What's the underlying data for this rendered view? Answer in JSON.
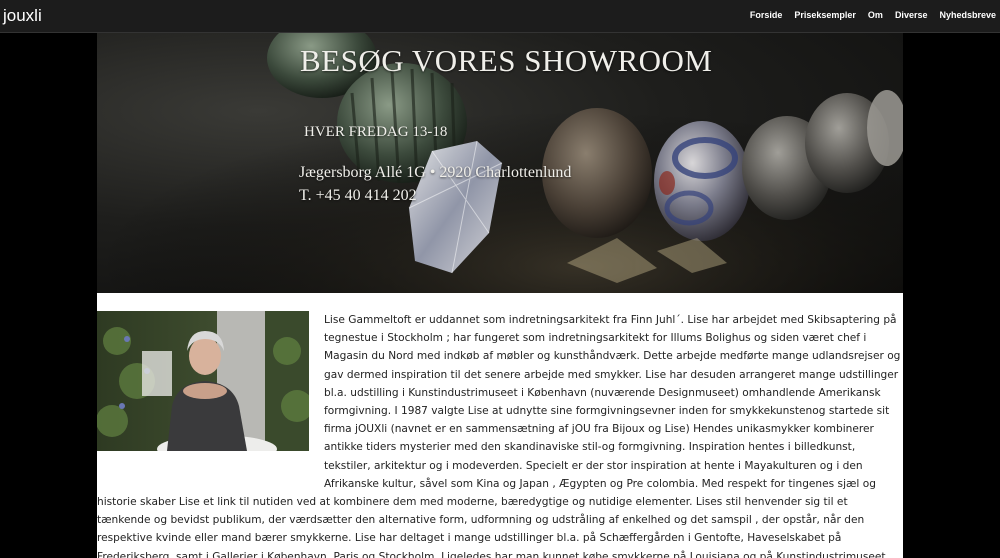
{
  "navbar": {
    "brand": "jouxli",
    "links": [
      "Forside",
      "Priseksempler",
      "Om",
      "Diverse",
      "Nyhedsbreve"
    ]
  },
  "hero": {
    "title": "BESØG VORES SHOWROOM",
    "days": "HVER FREDAG 13-18",
    "address": "Jægersborg Allé 1G • 2920 Charlottenlund",
    "phone": "T. +45 40 414 202"
  },
  "bio": {
    "text": "Lise Gammeltoft er uddannet som indretningsarkitekt fra Finn Juhl´. Lise har arbejdet med Skibsaptering på tegnestue i Stockholm ; har fungeret som indretningsarkitekt for Illums Bolighus og siden været chef i Magasin du Nord med indkøb af møbler og kunsthåndværk. Dette arbejde medførte mange udlandsrejser og gav dermed inspiration til det senere arbejde med smykker. Lise har desuden arrangeret mange udstillinger bl.a. udstilling i Kunstindustrimuseet i København (nuværende Designmuseet) omhandlende Amerikansk formgivning. I 1987 valgte Lise at udnytte sine formgivningsevner inden for smykkekunstenog startede sit firma jOUXli (navnet er en sammensætning af jOU fra Bijoux og Lise) Hendes unikasmykker kombinerer antikke tiders mysterier med den skandinaviske stil-og formgivning. Inspiration hentes i billedkunst, tekstiler, arkitektur og i modeverden. Specielt er der stor inspiration at hente i Mayakulturen og i den Afrikanske kultur, såvel som Kina og Japan , Ægypten og Pre colombia. Med respekt for tingenes sjæl og historie skaber Lise et link til nutiden ved at kombinere dem med moderne, bæredygtige og nutidige elementer. Lises stil henvender sig til et tænkende og bevidst publikum, der værdsætter den alternative form, udformning og udstråling af enkelhed og det samspil , der opstår, når den respektive kvinde eller mand bærer smykkerne. Lise har deltaget i mange udstillinger bl.a. på Schæffergården i Gentofte, Haveselskabet på Frederiksberg, samt  i Gallerier i København, Paris og Stockholm. Ligeledes har man kunnet købe smykkerne på Louisiana og på Kunstindustrimuseet. Nu forhandles alle smykker fra Lises hjem i Charlottenlund."
  }
}
